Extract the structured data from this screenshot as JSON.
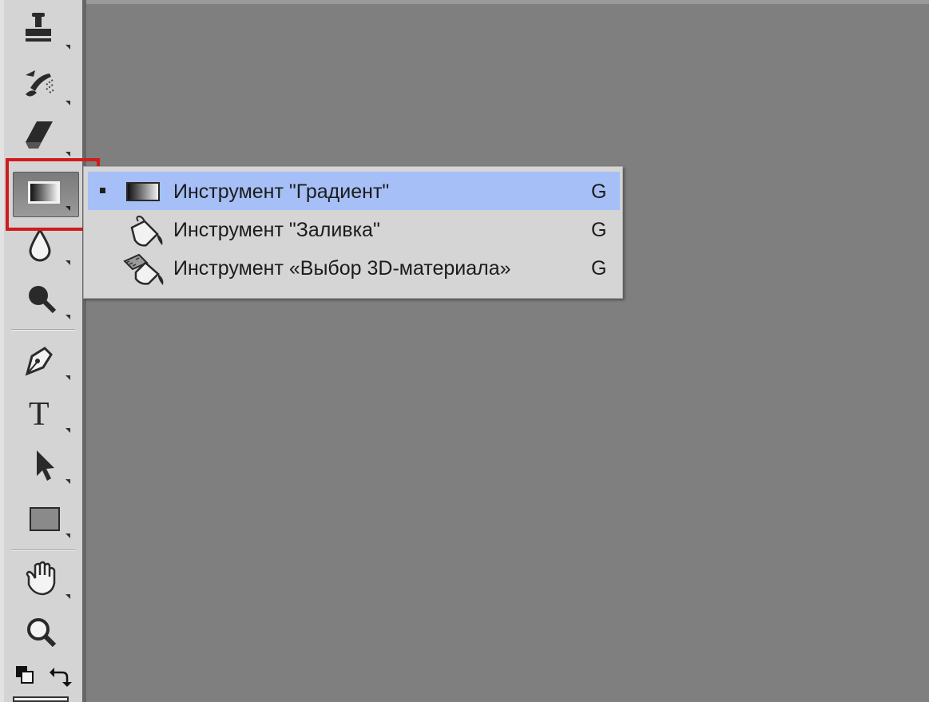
{
  "toolbar": {
    "tools": [
      {
        "name": "clone-stamp-icon"
      },
      {
        "name": "history-brush-icon"
      },
      {
        "name": "eraser-icon"
      },
      {
        "name": "gradient-icon",
        "active": true
      },
      {
        "name": "blur-icon"
      },
      {
        "name": "dodge-icon"
      },
      {
        "name": "pen-icon"
      },
      {
        "name": "type-icon",
        "glyph": "T"
      },
      {
        "name": "path-selection-icon"
      },
      {
        "name": "rectangle-shape-icon"
      },
      {
        "name": "hand-icon"
      },
      {
        "name": "zoom-icon"
      },
      {
        "name": "default-colors-icon"
      },
      {
        "name": "swap-colors-icon"
      }
    ]
  },
  "flyout": {
    "items": [
      {
        "label": "Инструмент \"Градиент\"",
        "shortcut": "G",
        "selected": true,
        "icon": "gradient-icon"
      },
      {
        "label": "Инструмент \"Заливка\"",
        "shortcut": "G",
        "selected": false,
        "icon": "paint-bucket-icon"
      },
      {
        "label": "Инструмент «Выбор 3D-материала»",
        "shortcut": "G",
        "selected": false,
        "icon": "3d-material-drop-icon"
      }
    ]
  },
  "colors": {
    "canvas": "#7f7f7f",
    "toolbar": "#d4d4d4",
    "highlight": "#a6bff6",
    "selection_frame": "#d01c1c"
  }
}
